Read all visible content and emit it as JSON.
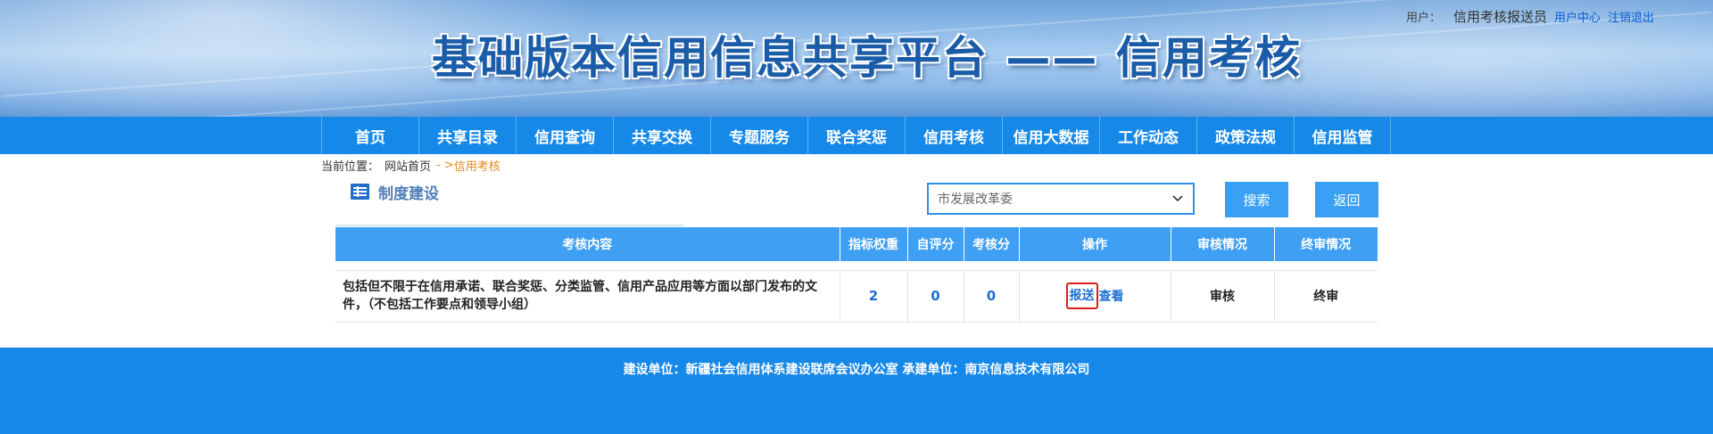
{
  "header": {
    "title": "基础版本信用信息共享平台 —— 信用考核",
    "user_label": "用户：",
    "user_name": "信用考核报送员",
    "user_center": "用户中心",
    "logout": "注销退出"
  },
  "nav": {
    "items": [
      {
        "label": "首页"
      },
      {
        "label": "共享目录"
      },
      {
        "label": "信用查询"
      },
      {
        "label": "共享交换"
      },
      {
        "label": "专题服务"
      },
      {
        "label": "联合奖惩"
      },
      {
        "label": "信用考核"
      },
      {
        "label": "信用大数据"
      },
      {
        "label": "工作动态"
      },
      {
        "label": "政策法规"
      },
      {
        "label": "信用监管"
      }
    ]
  },
  "breadcrumb": {
    "prefix": "当前位置：",
    "home": "网站首页",
    "arrow": "- >",
    "current": "信用考核"
  },
  "section": {
    "title": "制度建设",
    "icon": "document-list-icon"
  },
  "filter": {
    "department": "市发展改革委",
    "search_label": "搜索",
    "back_label": "返回"
  },
  "table": {
    "headers": [
      "考核内容",
      "指标权重",
      "自评分",
      "考核分",
      "操作",
      "审核情况",
      "终审情况"
    ],
    "rows": [
      {
        "content": "包括但不限于在信用承诺、联合奖惩、分类监管、信用产品应用等方面以部门发布的文件，（不包括工作要点和领导小组）",
        "weight": "2",
        "self_score": "0",
        "assess_score": "0",
        "op_report": "报送",
        "op_view": "查看",
        "review": "审核",
        "final": "终审"
      }
    ]
  },
  "footer": {
    "text": "建设单位：新疆社会信用体系建设联席会议办公室 承建单位：南京信息技术有限公司"
  },
  "colors": {
    "nav_bg": "#1688e8",
    "table_header_bg": "#3f9ff2",
    "button_bg": "#39a0f3",
    "highlight_border": "#e11b1b",
    "link": "#1d70d0",
    "breadcrumb_current": "#e08a1e"
  }
}
